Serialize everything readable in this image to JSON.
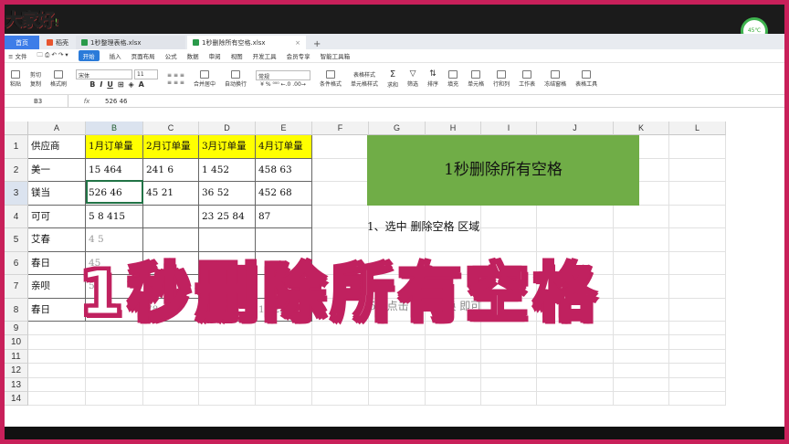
{
  "logo": {
    "text": "大家好",
    "mark": "!"
  },
  "temp": "45℃",
  "tabs": {
    "home": "首页",
    "pdf": "稻壳",
    "file1": "1秒整理表格.xlsx",
    "file2": "1秒删除所有空格.xlsx",
    "add": "+"
  },
  "menu": {
    "file": "≡ 文件",
    "start": "开始",
    "items": [
      "插入",
      "页面布局",
      "公式",
      "数据",
      "审阅",
      "视图",
      "开发工具",
      "会员专享",
      "智能工具箱"
    ]
  },
  "ribbon": {
    "paste": "粘贴",
    "cut": "剪切",
    "copy": "复制",
    "formatpaint": "格式刷",
    "font": "宋体",
    "size": "11",
    "merge": "合并居中",
    "wrap": "自动换行",
    "numfmt": "常规",
    "cond": "条件格式",
    "tablestyle": "表格样式",
    "cellstyle": "单元格样式",
    "sum": "求和",
    "filter": "筛选",
    "sort": "排序",
    "fill": "填充",
    "cellbtn": "单元格",
    "rowcol": "行和列",
    "sheet": "工作表",
    "freeze": "冻结窗格",
    "tools": "表格工具"
  },
  "formula": {
    "name": "B3",
    "fx": "fx",
    "value": "526 46"
  },
  "columns": [
    "A",
    "B",
    "C",
    "D",
    "E",
    "F",
    "G",
    "H",
    "I",
    "J",
    "K",
    "L"
  ],
  "rows": [
    "1",
    "2",
    "3",
    "4",
    "5",
    "6",
    "7",
    "8",
    "9",
    "10",
    "11",
    "12",
    "13",
    "14"
  ],
  "table": {
    "headers": [
      "供应商",
      "1月订单量",
      "2月订单量",
      "3月订单量",
      "4月订单量"
    ],
    "data": [
      [
        "美一",
        "15  464",
        "241 6",
        "1 452",
        "458 63"
      ],
      [
        "镁当",
        "526 46",
        "45 21",
        "36 52",
        "452 68"
      ],
      [
        "可可",
        "5  8 415",
        "",
        "23 25 84",
        "87"
      ],
      [
        "艾春",
        "4 5",
        "",
        "",
        ""
      ],
      [
        "春日",
        "45",
        "",
        "",
        ""
      ],
      [
        "亲呗",
        "54",
        "",
        "",
        ""
      ],
      [
        "春日",
        "1  4523",
        "78 96",
        "7896",
        "1 5236"
      ]
    ]
  },
  "titlebox": "1秒删除所有空格",
  "steps": [
    "1、选中 删除空格 区域",
    "容\"",
    "5、点击 全部替换 即可"
  ],
  "overlay": "1秒删除所有空格"
}
